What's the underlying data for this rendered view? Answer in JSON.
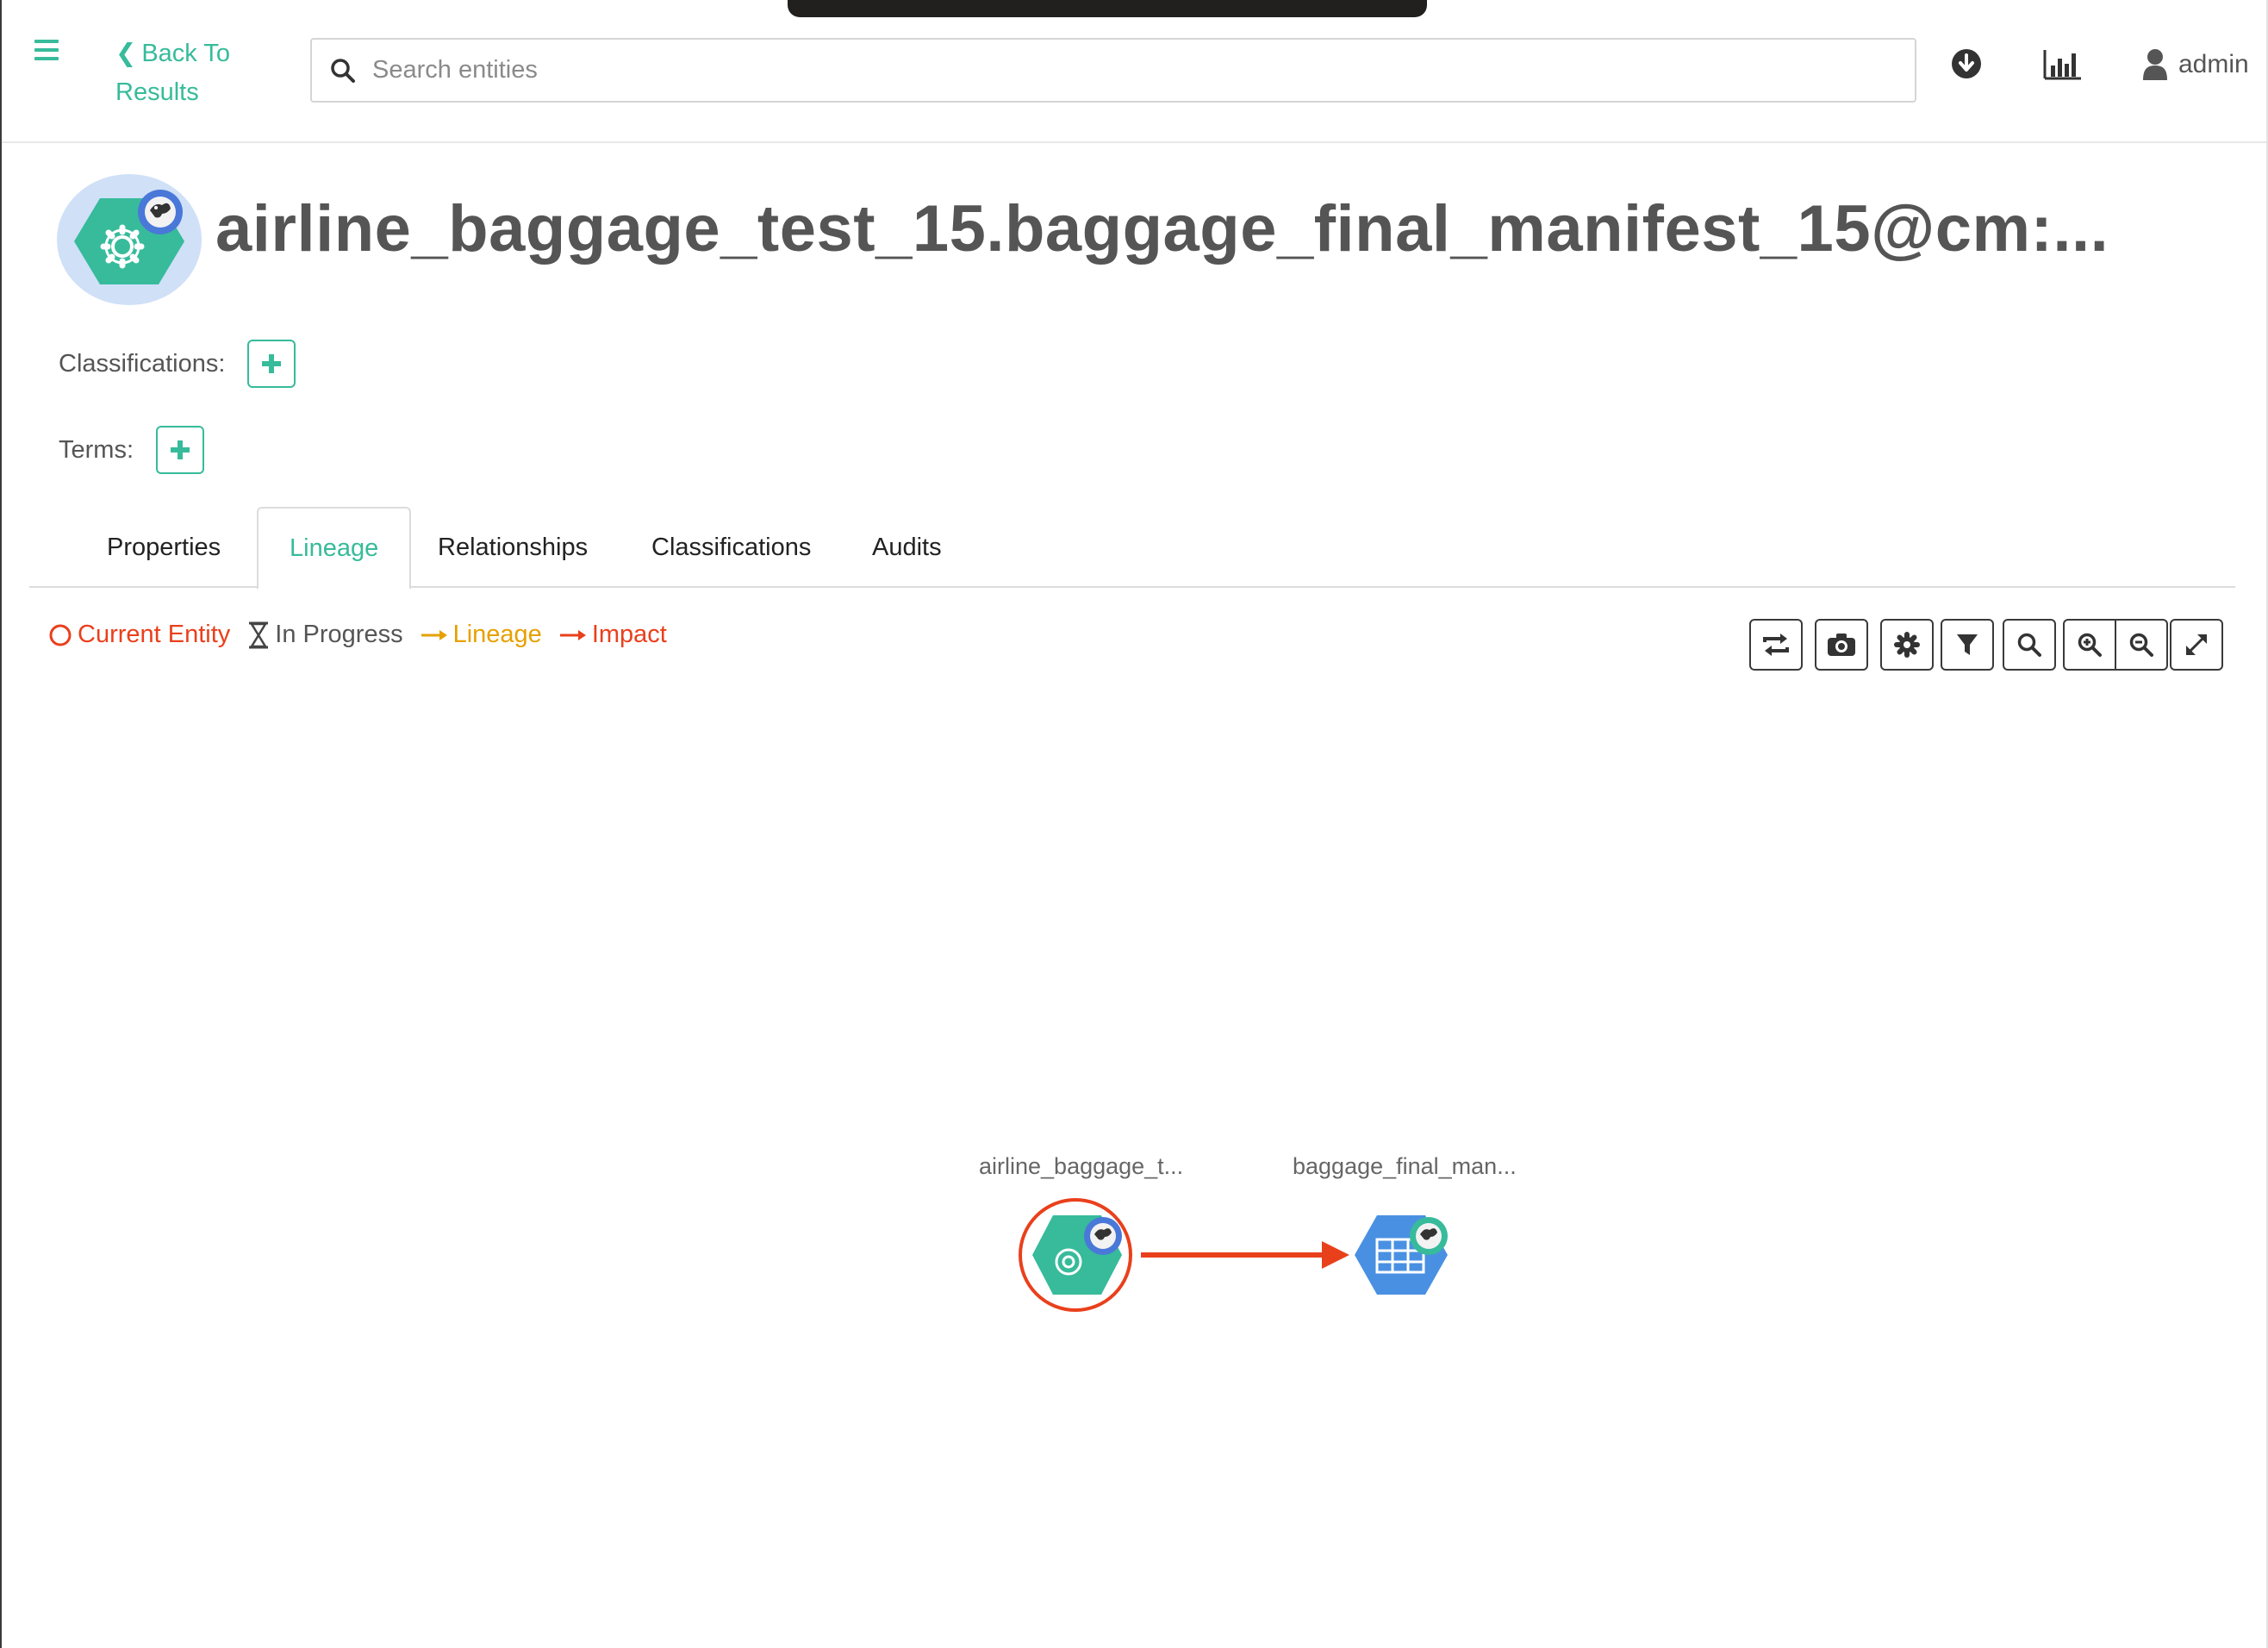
{
  "header": {
    "back_label_line1": "Back To",
    "back_label_line2": "Results",
    "search_placeholder": "Search entities",
    "user_name": "admin"
  },
  "entity": {
    "title": "airline_baggage_test_15.baggage_final_manifest_15@cm:...",
    "classifications_label": "Classifications:",
    "terms_label": "Terms:"
  },
  "tabs": [
    {
      "label": "Properties",
      "active": false
    },
    {
      "label": "Lineage",
      "active": true
    },
    {
      "label": "Relationships",
      "active": false
    },
    {
      "label": "Classifications",
      "active": false
    },
    {
      "label": "Audits",
      "active": false
    }
  ],
  "legend": {
    "current_entity": "Current Entity",
    "in_progress": "In Progress",
    "lineage": "Lineage",
    "impact": "Impact"
  },
  "lineage_nodes": [
    {
      "label": "airline_baggage_t...",
      "type": "process",
      "current": true
    },
    {
      "label": "baggage_final_man...",
      "type": "table",
      "current": false
    }
  ],
  "colors": {
    "accent": "#37bb9b",
    "current": "#e9401c",
    "lineage": "#e6a100",
    "impact": "#e9401c",
    "process_node": "#37bb9b",
    "table_node": "#4a90e2"
  }
}
